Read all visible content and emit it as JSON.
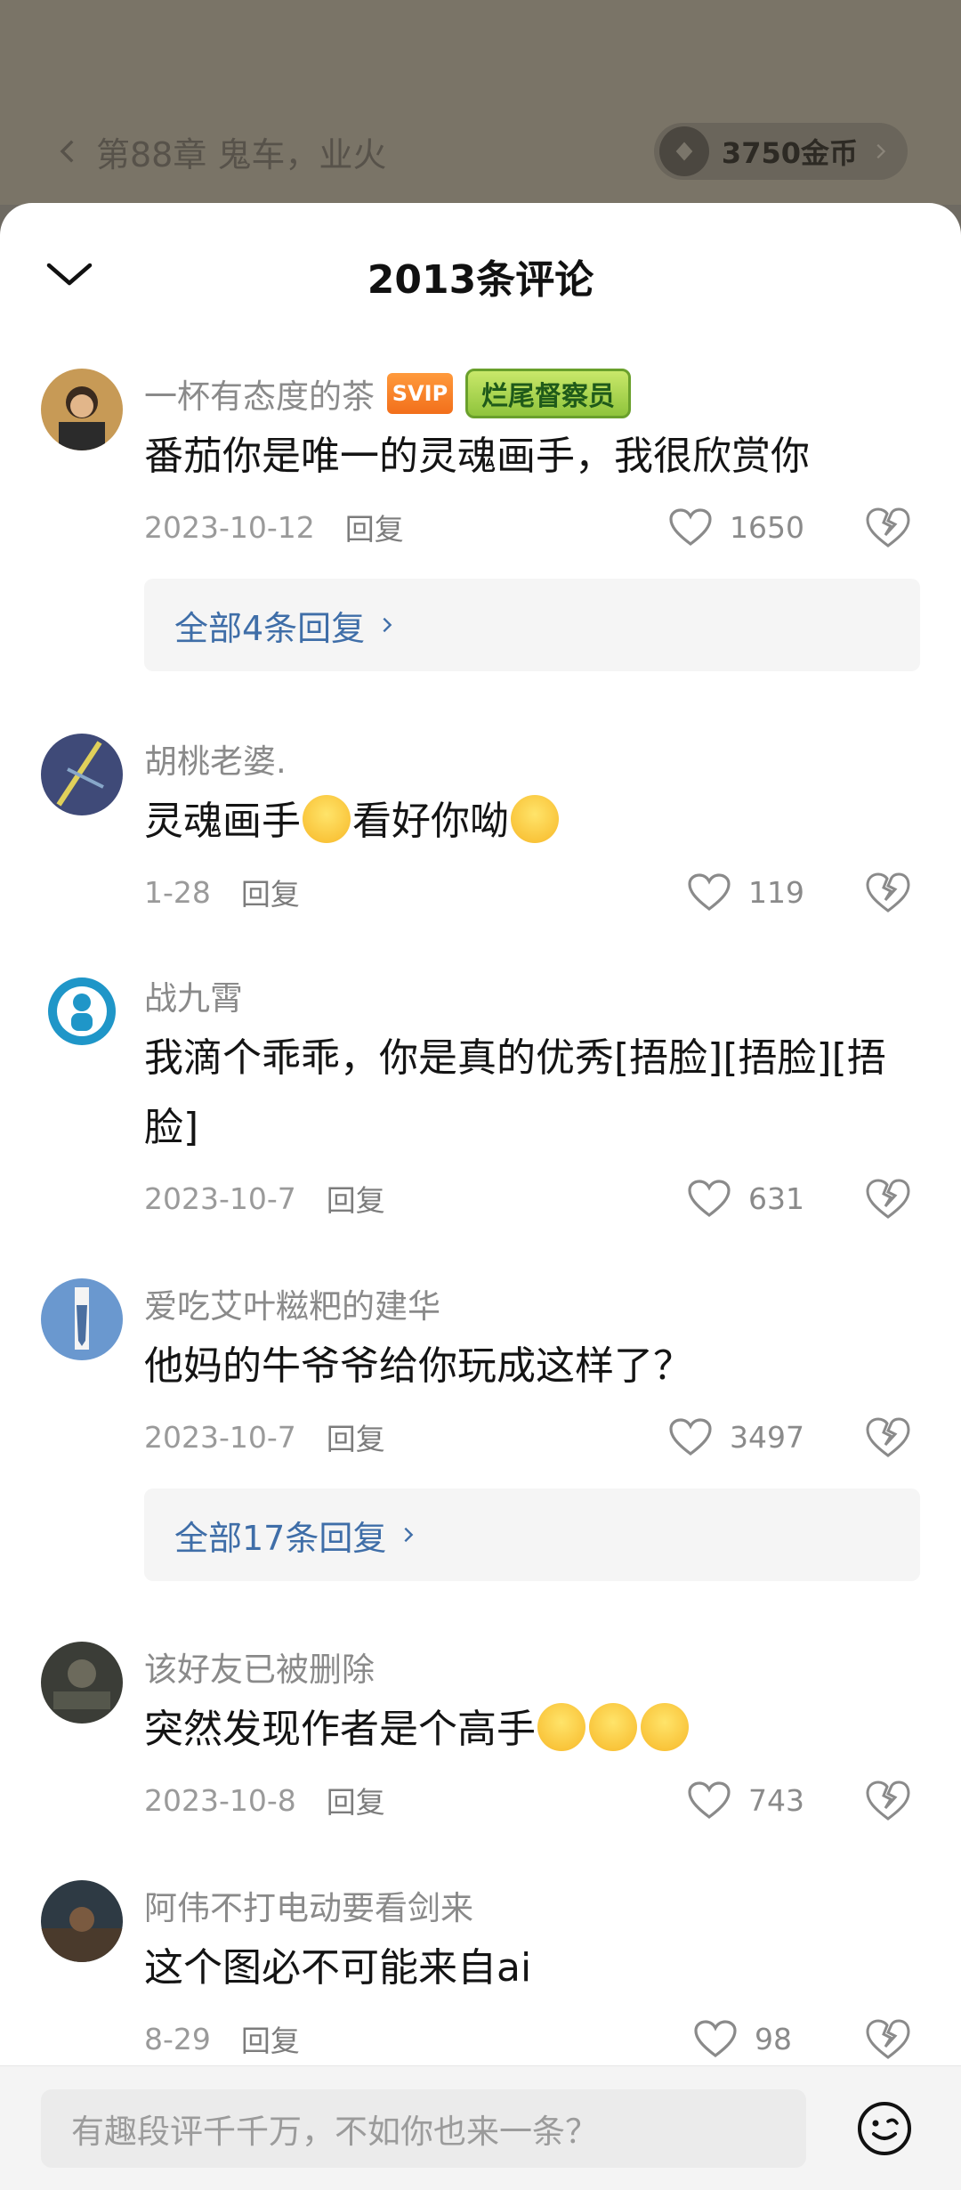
{
  "chapter_bar": {
    "chapter_title": "第88章 鬼车，业火",
    "coins": "3750金币"
  },
  "sheet": {
    "title": "2013条评论"
  },
  "comments": [
    {
      "name": "一杯有态度的茶",
      "badge_svip": "SVIP",
      "badge_medal": "烂尾督察员",
      "text": "番茄你是唯一的灵魂画手，我很欣赏你",
      "date": "2023-10-12",
      "reply": "回复",
      "likes": "1650",
      "replies_link": "全部4条回复"
    },
    {
      "name": "胡桃老婆.",
      "text_parts": [
        "灵魂画手",
        "看好你呦"
      ],
      "date": "1-28",
      "reply": "回复",
      "likes": "119"
    },
    {
      "name": "战九霄",
      "text": "我滴个乖乖，你是真的优秀[捂脸][捂脸][捂脸]",
      "date": "2023-10-7",
      "reply": "回复",
      "likes": "631"
    },
    {
      "name": "爱吃艾叶糍粑的建华",
      "text": "他妈的牛爷爷给你玩成这样了？",
      "date": "2023-10-7",
      "reply": "回复",
      "likes": "3497",
      "replies_link": "全部17条回复"
    },
    {
      "name": "该好友已被删除",
      "text": "突然发现作者是个高手",
      "date": "2023-10-8",
      "reply": "回复",
      "likes": "743"
    },
    {
      "name": "阿伟不打电动要看剑来",
      "text": "这个图必不可能来自ai",
      "date": "8-29",
      "reply": "回复",
      "likes": "98"
    }
  ],
  "input": {
    "placeholder": "有趣段评千千万，不如你也来一条？"
  }
}
